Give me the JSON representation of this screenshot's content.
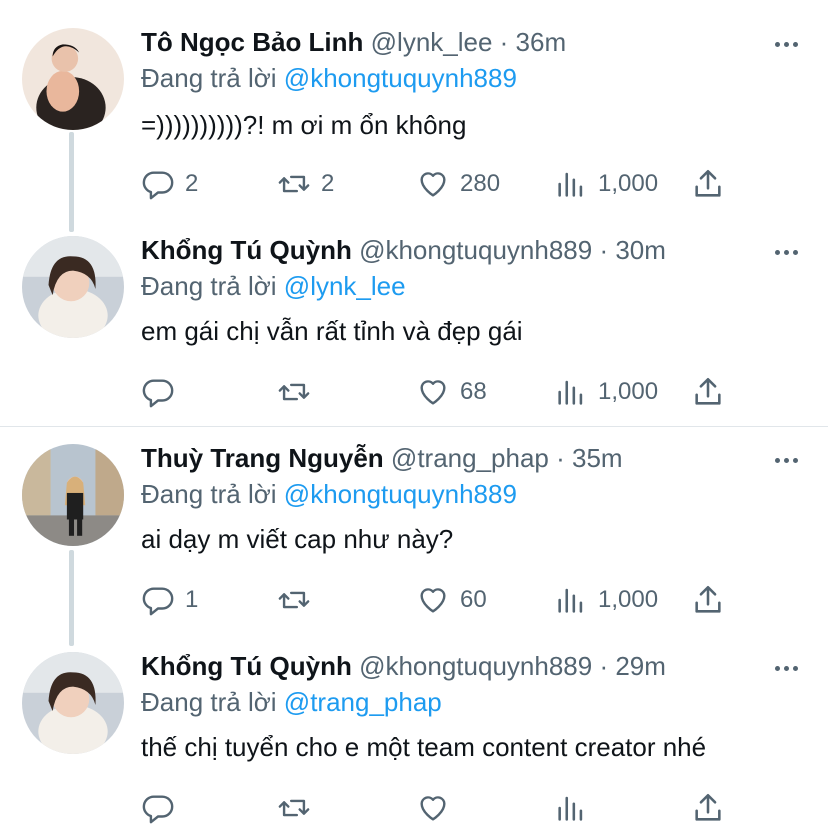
{
  "replying_prefix": "Đang trả lời",
  "tweets": [
    {
      "name": "Tô Ngọc Bảo Linh",
      "meta": "@lynk_lee · 36m",
      "reply_to": "@khongtuquynh889",
      "text": "=))))))))))?! m ơi m ổn không",
      "replies": "2",
      "retweets": "2",
      "likes": "280",
      "views": "1,000"
    },
    {
      "name": "Khổng Tú Quỳnh",
      "meta": "@khongtuquynh889 · 30m",
      "reply_to": "@lynk_lee",
      "text": "em gái chị vẫn rất tỉnh và đẹp gái",
      "replies": "",
      "retweets": "",
      "likes": "68",
      "views": "1,000"
    },
    {
      "name": "Thuỳ Trang Nguyễn",
      "meta": "@trang_phap · 35m",
      "reply_to": "@khongtuquynh889",
      "text": "ai dạy m viết cap như này?",
      "replies": "1",
      "retweets": "",
      "likes": "60",
      "views": "1,000"
    },
    {
      "name": "Khổng Tú Quỳnh",
      "meta": "@khongtuquynh889 · 29m",
      "reply_to": "@trang_phap",
      "text": "thế chị tuyển cho e một team content creator nhé",
      "replies": "",
      "retweets": "",
      "likes": "",
      "views": ""
    }
  ],
  "colors": {
    "link": "#1d9bf0",
    "muted": "#536471",
    "thread_line": "#cfd9de"
  },
  "icons": [
    "reply-icon",
    "retweet-icon",
    "like-icon",
    "views-icon",
    "share-icon",
    "more-icon"
  ]
}
